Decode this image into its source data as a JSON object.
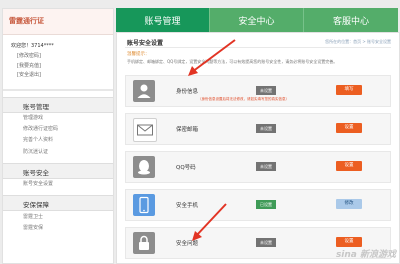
{
  "sidebar": {
    "brand": "雷霆通行证",
    "welcome": "欢迎您！3714****",
    "links": [
      "[修改密码]",
      "[我要充值]",
      "[安全退出]"
    ],
    "sections": [
      {
        "title": "账号管理",
        "items": [
          "管理游戏",
          "修改通行证密码",
          "完善个人资料",
          "防沉迷认证"
        ]
      },
      {
        "title": "账号安全",
        "items": [
          "账号安全设置"
        ]
      },
      {
        "title": "安保保障",
        "items": [
          "雷霆卫士",
          "雷霆安保"
        ]
      }
    ]
  },
  "tabs": [
    "账号管理",
    "安全中心",
    "客服中心"
  ],
  "main": {
    "title": "账号安全设置",
    "breadcrumb": "您所在的位置：首页 > 账号安全设置",
    "tip_label": "温馨提示：",
    "tip_text": "手机绑定、邮箱绑定、QQ号绑定，设置安全问题等方法，可以有效提高您的账号安全性，请务必将账号安全设置完善。"
  },
  "security_items": [
    {
      "name": "身份信息",
      "status": "未设置",
      "action": "填写",
      "note": "（身份信息设置后将无法修改，请如实填写您的真实信息）",
      "icon": "user-icon"
    },
    {
      "name": "保密邮箱",
      "status": "未设置",
      "action": "设置",
      "icon": "mail-icon"
    },
    {
      "name": "QQ号码",
      "status": "未设置",
      "action": "设置",
      "icon": "qq-icon"
    },
    {
      "name": "安全手机",
      "status": "已设置",
      "action": "修改",
      "icon": "phone-icon"
    },
    {
      "name": "安全问题",
      "status": "未设置",
      "action": "设置",
      "icon": "lock-icon"
    }
  ],
  "watermark": "sina 新浪游戏",
  "colors": {
    "tab_active": "#17975a",
    "tab": "#54ad6a",
    "action": "#ec5e21",
    "arrow": "#e23424"
  }
}
